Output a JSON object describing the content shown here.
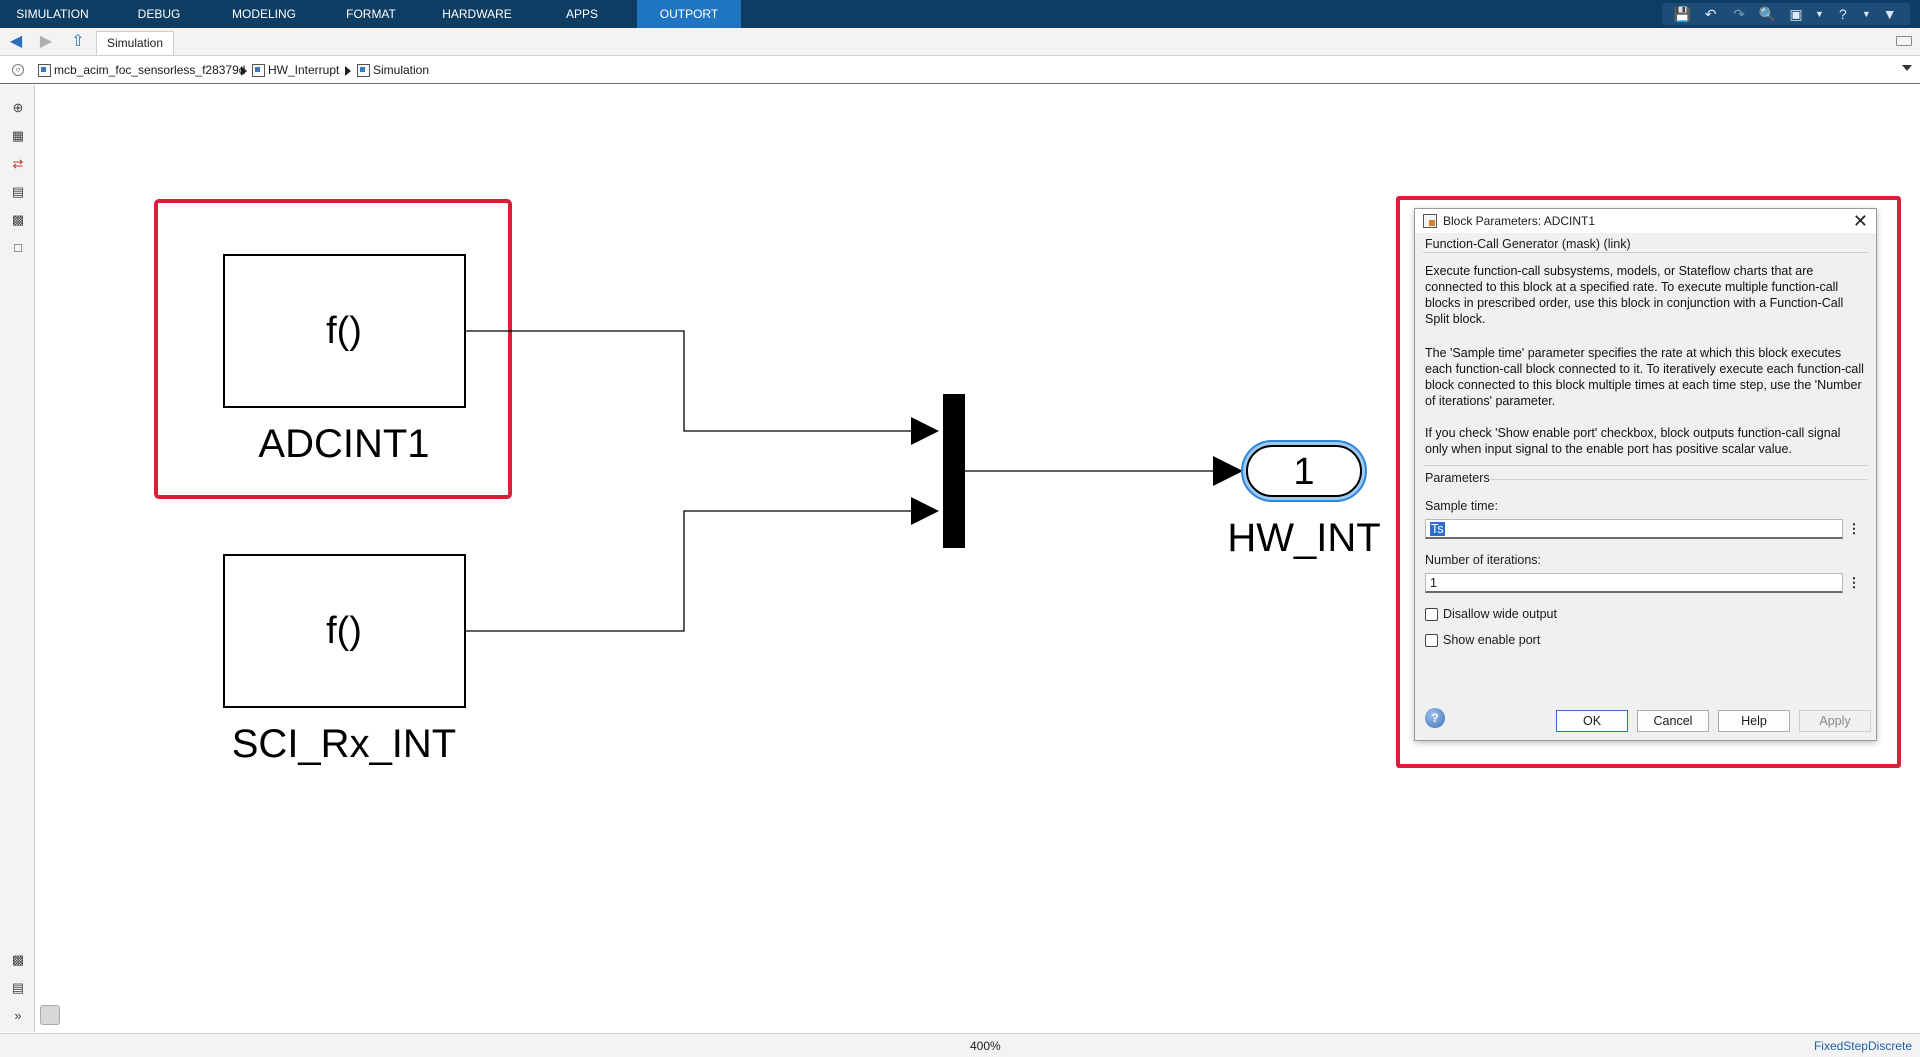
{
  "ribbon": {
    "tabs": [
      "SIMULATION",
      "DEBUG",
      "MODELING",
      "FORMAT",
      "HARDWARE",
      "APPS",
      "OUTPORT"
    ],
    "active_tab": "OUTPORT",
    "colors": {
      "background": "#0e3d63",
      "active": "#1f75c2"
    }
  },
  "quick_access": {
    "icons": [
      "save-icon",
      "undo-icon",
      "redo-icon",
      "find-icon",
      "zoom-icon",
      "dropdown-icon",
      "help-icon",
      "dropdown-icon",
      "collapse-icon"
    ]
  },
  "nav": {
    "model_tab": "Simulation"
  },
  "breadcrumb": {
    "items": [
      "mcb_acim_foc_sensorless_f28379d",
      "HW_Interrupt",
      "Simulation"
    ]
  },
  "diagram": {
    "blocks": [
      {
        "label": "ADCINT1",
        "content": "f()",
        "selected": true
      },
      {
        "label": "SCI_Rx_INT",
        "content": "f()",
        "selected": false
      }
    ],
    "outport": {
      "number": "1",
      "label": "HW_INT"
    },
    "highlight_color": "#d8203a"
  },
  "dialog": {
    "title": "Block Parameters: ADCINT1",
    "group_title": "Function-Call Generator (mask) (link)",
    "description": [
      "Execute function-call subsystems, models, or Stateflow charts that are connected to this block at a specified rate. To execute multiple function-call blocks in prescribed order, use this block in conjunction with a Function-Call Split block.",
      "The 'Sample time' parameter specifies the rate at which this block executes each function-call block connected to it. To iteratively execute each function-call block connected to this block multiple times at each time step,  use the 'Number of iterations' parameter.",
      "If you check 'Show enable port' checkbox, block outputs function-call signal only when input signal to the enable port has positive scalar value."
    ],
    "params_title": "Parameters",
    "sample_time": {
      "label": "Sample time:",
      "value": "Ts"
    },
    "iterations": {
      "label": "Number of iterations:",
      "value": "1"
    },
    "checkboxes": [
      {
        "label": "Disallow wide output",
        "checked": false
      },
      {
        "label": "Show enable port",
        "checked": false
      }
    ],
    "buttons": {
      "ok": "OK",
      "cancel": "Cancel",
      "help": "Help",
      "apply": "Apply"
    }
  },
  "status": {
    "zoom": "400%",
    "solver": "FixedStepDiscrete"
  }
}
